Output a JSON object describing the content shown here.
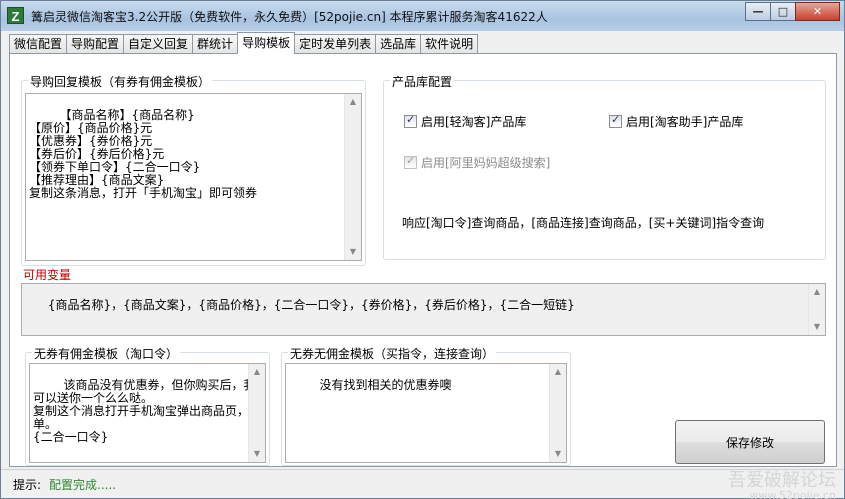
{
  "window": {
    "title": "篝启灵微信淘客宝3.2公开版（免费软件，永久免费）[52pojie.cn]  本程序累计服务淘客41622人",
    "icon_letter": "Z",
    "controls": {
      "minimize": "—",
      "maximize": "□",
      "close": "✕"
    }
  },
  "tabs": [
    {
      "label": "微信配置",
      "active": false
    },
    {
      "label": "导购配置",
      "active": false
    },
    {
      "label": "自定义回复",
      "active": false
    },
    {
      "label": "群统计",
      "active": false
    },
    {
      "label": "导购模板",
      "active": true
    },
    {
      "label": "定时发单列表",
      "active": false
    },
    {
      "label": "选品库",
      "active": false
    },
    {
      "label": "软件说明",
      "active": false
    }
  ],
  "guide_template": {
    "title": "导购回复模板（有券有佣金模板）",
    "value": "【商品名称】{商品名称}\n【原价】{商品价格}元\n【优惠券】{券价格}元\n【券后价】{券后价格}元\n【领券下单口令】{二合一口令}\n【推荐理由】{商品文案}\n复制这条消息，打开「手机淘宝」即可领券"
  },
  "product_library": {
    "title": "产品库配置",
    "checkboxes": [
      {
        "label": "启用[轻淘客]产品库",
        "checked": true,
        "enabled": true
      },
      {
        "label": "启用[淘客助手]产品库",
        "checked": true,
        "enabled": true
      },
      {
        "label": "启用[阿里妈妈超级搜索]",
        "checked": true,
        "enabled": false
      }
    ],
    "note": "响应[淘口令]查询商品，[商品连接]查询商品，[买+关键词]指令查询"
  },
  "variables": {
    "label": "可用变量",
    "value": "{商品名称}，{商品文案}，{商品价格}，{二合一口令}，{券价格}，{券后价格}，{二合一短链}"
  },
  "no_coupon_with_commission": {
    "title": "无券有佣金模板（淘口令）",
    "value": "该商品没有优惠券，但你购买后，我可以送你一个么么哒。\n复制这个消息打开手机淘宝弹出商品页，下单。\n{二合一口令}"
  },
  "no_coupon_no_commission": {
    "title": "无券无佣金模板（买指令，连接查询）",
    "value": "没有找到相关的优惠券噢"
  },
  "save_button": "保存修改",
  "status": {
    "label": "提示:",
    "message": "配置完成....."
  },
  "watermark": {
    "line1": "吾爱破解论坛",
    "line2": "www.52pojie.cn"
  }
}
